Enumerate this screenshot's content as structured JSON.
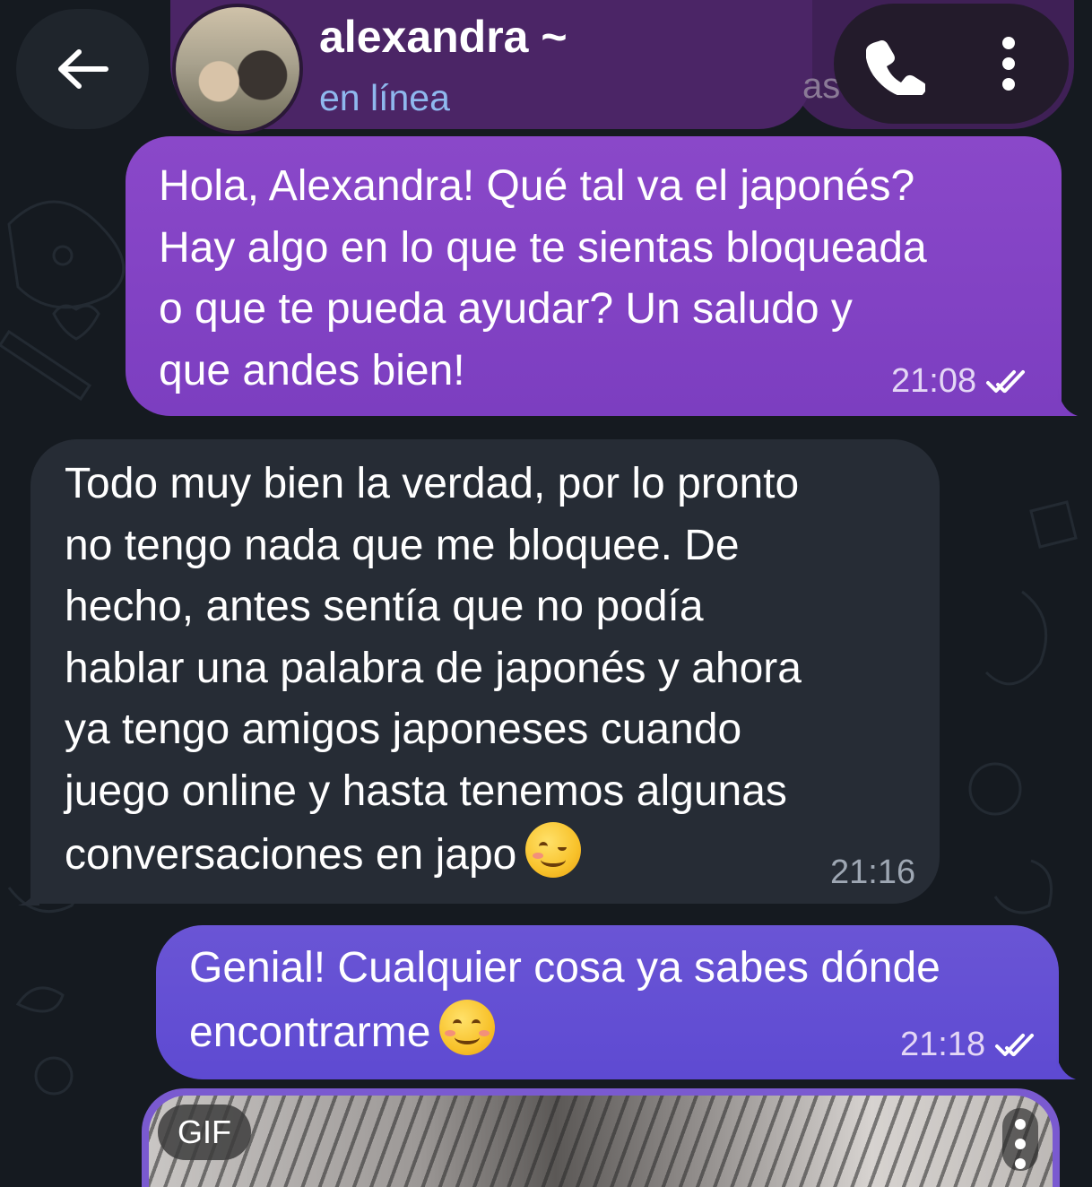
{
  "header": {
    "contact_name": "alexandra ~",
    "status": "en línea",
    "partial_text": "as",
    "icons": {
      "back": "arrow-left-icon",
      "call": "phone-icon",
      "menu": "more-vertical-icon"
    }
  },
  "messages": [
    {
      "direction": "outgoing",
      "text": "Hola, Alexandra! Qué tal va el japonés?\nHay algo en lo que te sientas bloqueada\no que te pueda ayudar? Un saludo y\nque andes bien!",
      "time": "21:08",
      "status_icon": "double-check-icon"
    },
    {
      "direction": "incoming",
      "text": "Todo muy bien la verdad, por lo pronto\nno tengo nada que me bloquee. De\nhecho, antes sentía que no podía\nhablar una palabra de japonés y ahora\nya tengo amigos japoneses cuando\njuego online y hasta tenemos algunas\nconversaciones en japo",
      "emoji": "winking-face-emoji",
      "time": "21:16"
    },
    {
      "direction": "outgoing",
      "text": "Genial! Cualquier cosa ya sabes dónde\nencontrarme",
      "emoji": "smiling-face-emoji",
      "time": "21:18",
      "status_icon": "double-check-icon"
    }
  ],
  "gif_message": {
    "badge": "GIF",
    "menu_icon": "more-vertical-icon"
  },
  "colors": {
    "background": "#151a20",
    "outgoing_bubble_1": "#8545c6",
    "outgoing_bubble_2": "#6450d3",
    "incoming_bubble": "#262c35",
    "status_text": "#8fb8ee",
    "header": "#4b2566"
  }
}
